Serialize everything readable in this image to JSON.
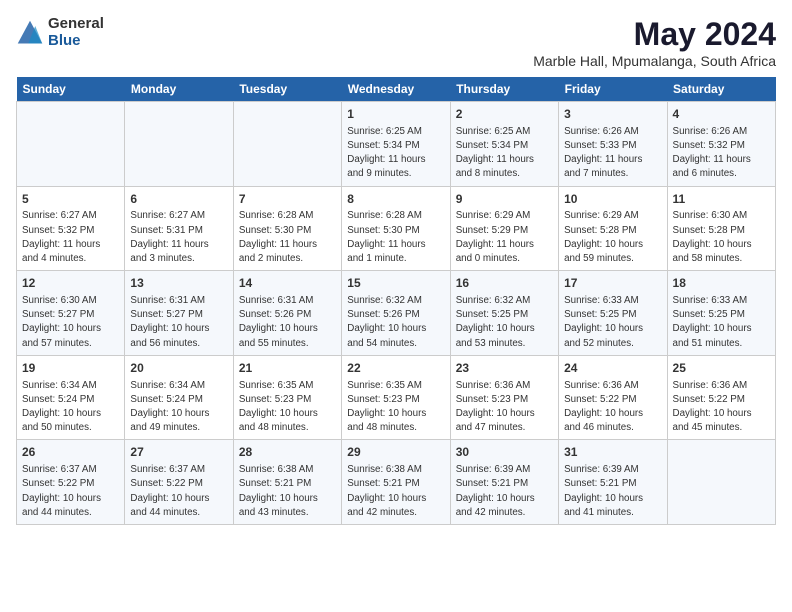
{
  "header": {
    "logo_general": "General",
    "logo_blue": "Blue",
    "title": "May 2024",
    "subtitle": "Marble Hall, Mpumalanga, South Africa"
  },
  "weekdays": [
    "Sunday",
    "Monday",
    "Tuesday",
    "Wednesday",
    "Thursday",
    "Friday",
    "Saturday"
  ],
  "weeks": [
    [
      {
        "day": "",
        "info": ""
      },
      {
        "day": "",
        "info": ""
      },
      {
        "day": "",
        "info": ""
      },
      {
        "day": "1",
        "info": "Sunrise: 6:25 AM\nSunset: 5:34 PM\nDaylight: 11 hours\nand 9 minutes."
      },
      {
        "day": "2",
        "info": "Sunrise: 6:25 AM\nSunset: 5:34 PM\nDaylight: 11 hours\nand 8 minutes."
      },
      {
        "day": "3",
        "info": "Sunrise: 6:26 AM\nSunset: 5:33 PM\nDaylight: 11 hours\nand 7 minutes."
      },
      {
        "day": "4",
        "info": "Sunrise: 6:26 AM\nSunset: 5:32 PM\nDaylight: 11 hours\nand 6 minutes."
      }
    ],
    [
      {
        "day": "5",
        "info": "Sunrise: 6:27 AM\nSunset: 5:32 PM\nDaylight: 11 hours\nand 4 minutes."
      },
      {
        "day": "6",
        "info": "Sunrise: 6:27 AM\nSunset: 5:31 PM\nDaylight: 11 hours\nand 3 minutes."
      },
      {
        "day": "7",
        "info": "Sunrise: 6:28 AM\nSunset: 5:30 PM\nDaylight: 11 hours\nand 2 minutes."
      },
      {
        "day": "8",
        "info": "Sunrise: 6:28 AM\nSunset: 5:30 PM\nDaylight: 11 hours\nand 1 minute."
      },
      {
        "day": "9",
        "info": "Sunrise: 6:29 AM\nSunset: 5:29 PM\nDaylight: 11 hours\nand 0 minutes."
      },
      {
        "day": "10",
        "info": "Sunrise: 6:29 AM\nSunset: 5:28 PM\nDaylight: 10 hours\nand 59 minutes."
      },
      {
        "day": "11",
        "info": "Sunrise: 6:30 AM\nSunset: 5:28 PM\nDaylight: 10 hours\nand 58 minutes."
      }
    ],
    [
      {
        "day": "12",
        "info": "Sunrise: 6:30 AM\nSunset: 5:27 PM\nDaylight: 10 hours\nand 57 minutes."
      },
      {
        "day": "13",
        "info": "Sunrise: 6:31 AM\nSunset: 5:27 PM\nDaylight: 10 hours\nand 56 minutes."
      },
      {
        "day": "14",
        "info": "Sunrise: 6:31 AM\nSunset: 5:26 PM\nDaylight: 10 hours\nand 55 minutes."
      },
      {
        "day": "15",
        "info": "Sunrise: 6:32 AM\nSunset: 5:26 PM\nDaylight: 10 hours\nand 54 minutes."
      },
      {
        "day": "16",
        "info": "Sunrise: 6:32 AM\nSunset: 5:25 PM\nDaylight: 10 hours\nand 53 minutes."
      },
      {
        "day": "17",
        "info": "Sunrise: 6:33 AM\nSunset: 5:25 PM\nDaylight: 10 hours\nand 52 minutes."
      },
      {
        "day": "18",
        "info": "Sunrise: 6:33 AM\nSunset: 5:25 PM\nDaylight: 10 hours\nand 51 minutes."
      }
    ],
    [
      {
        "day": "19",
        "info": "Sunrise: 6:34 AM\nSunset: 5:24 PM\nDaylight: 10 hours\nand 50 minutes."
      },
      {
        "day": "20",
        "info": "Sunrise: 6:34 AM\nSunset: 5:24 PM\nDaylight: 10 hours\nand 49 minutes."
      },
      {
        "day": "21",
        "info": "Sunrise: 6:35 AM\nSunset: 5:23 PM\nDaylight: 10 hours\nand 48 minutes."
      },
      {
        "day": "22",
        "info": "Sunrise: 6:35 AM\nSunset: 5:23 PM\nDaylight: 10 hours\nand 48 minutes."
      },
      {
        "day": "23",
        "info": "Sunrise: 6:36 AM\nSunset: 5:23 PM\nDaylight: 10 hours\nand 47 minutes."
      },
      {
        "day": "24",
        "info": "Sunrise: 6:36 AM\nSunset: 5:22 PM\nDaylight: 10 hours\nand 46 minutes."
      },
      {
        "day": "25",
        "info": "Sunrise: 6:36 AM\nSunset: 5:22 PM\nDaylight: 10 hours\nand 45 minutes."
      }
    ],
    [
      {
        "day": "26",
        "info": "Sunrise: 6:37 AM\nSunset: 5:22 PM\nDaylight: 10 hours\nand 44 minutes."
      },
      {
        "day": "27",
        "info": "Sunrise: 6:37 AM\nSunset: 5:22 PM\nDaylight: 10 hours\nand 44 minutes."
      },
      {
        "day": "28",
        "info": "Sunrise: 6:38 AM\nSunset: 5:21 PM\nDaylight: 10 hours\nand 43 minutes."
      },
      {
        "day": "29",
        "info": "Sunrise: 6:38 AM\nSunset: 5:21 PM\nDaylight: 10 hours\nand 42 minutes."
      },
      {
        "day": "30",
        "info": "Sunrise: 6:39 AM\nSunset: 5:21 PM\nDaylight: 10 hours\nand 42 minutes."
      },
      {
        "day": "31",
        "info": "Sunrise: 6:39 AM\nSunset: 5:21 PM\nDaylight: 10 hours\nand 41 minutes."
      },
      {
        "day": "",
        "info": ""
      }
    ]
  ]
}
